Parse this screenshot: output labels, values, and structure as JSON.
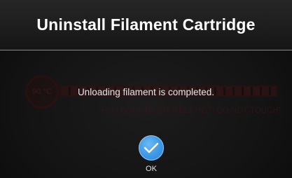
{
  "header": {
    "title": "Uninstall Filament Cartridge"
  },
  "background": {
    "temperature": "90 °C",
    "warning": "Print Bed is EXTREMELY HOT! DO NOT TOUCH!"
  },
  "dialog": {
    "message": "Unloading filament is completed.",
    "ok_label": "OK",
    "ok_icon": "checkmark-icon",
    "accent_color": "#3d98e6"
  }
}
